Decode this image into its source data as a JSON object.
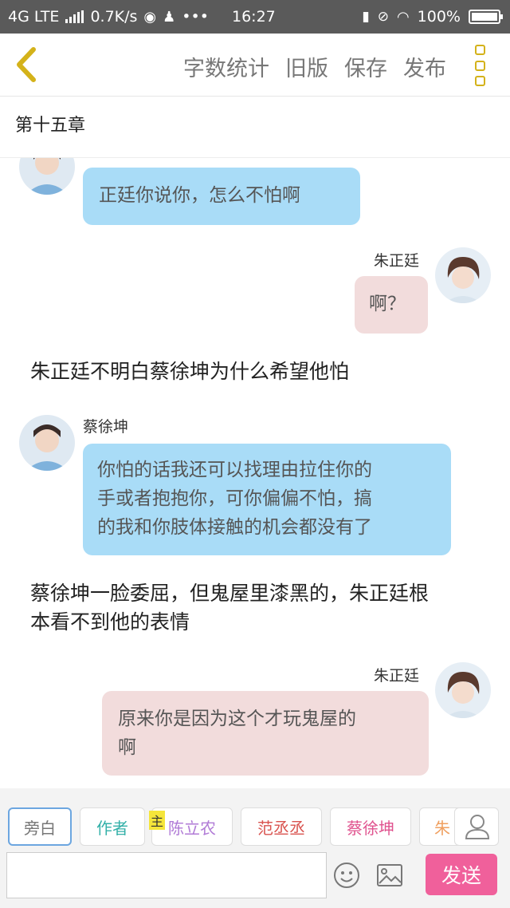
{
  "status_bar": {
    "network": "4G LTE",
    "speed": "0.7K/s",
    "time": "16:27",
    "battery": "100%"
  },
  "header": {
    "actions": [
      "字数统计",
      "旧版",
      "保存",
      "发布"
    ]
  },
  "chapter": {
    "title": "第十五章"
  },
  "messages": [
    {
      "text": "正廷你说你，怎么不怕啊"
    },
    {
      "speaker": "朱正廷",
      "text": "啊？"
    },
    {
      "narration": "朱正廷不明白蔡徐坤为什么希望他怕"
    },
    {
      "speaker": "蔡徐坤",
      "lines": [
        "你怕的话我还可以找理由拉住你的",
        "手或者抱抱你，可你偏偏不怕，搞",
        "的我和你肢体接触的机会都没有了"
      ]
    },
    {
      "narration_lines": [
        "蔡徐坤一脸委屈，但鬼屋里漆黑的，朱正廷根",
        "本看不到他的表情"
      ]
    },
    {
      "speaker": "朱正廷",
      "lines": [
        "原来你是因为这个才玩鬼屋的",
        "啊"
      ]
    }
  ],
  "toolbar": {
    "roles": [
      {
        "label": "旁白",
        "color": "#777777"
      },
      {
        "label": "作者",
        "color": "#33b0a8"
      },
      {
        "label": "陈立农",
        "color": "#b07ad6"
      },
      {
        "label": "范丞丞",
        "color": "#d9534f"
      },
      {
        "label": "蔡徐坤",
        "color": "#e0538f"
      },
      {
        "label": "朱",
        "color": "#f0a060"
      }
    ],
    "main_badge": "主",
    "send_label": "发送"
  },
  "colors": {
    "accent_yellow": "#d4b21a",
    "bubble_blue": "#a9dcf7",
    "bubble_pink": "#f2dcdc",
    "send_pink": "#f0609b"
  }
}
